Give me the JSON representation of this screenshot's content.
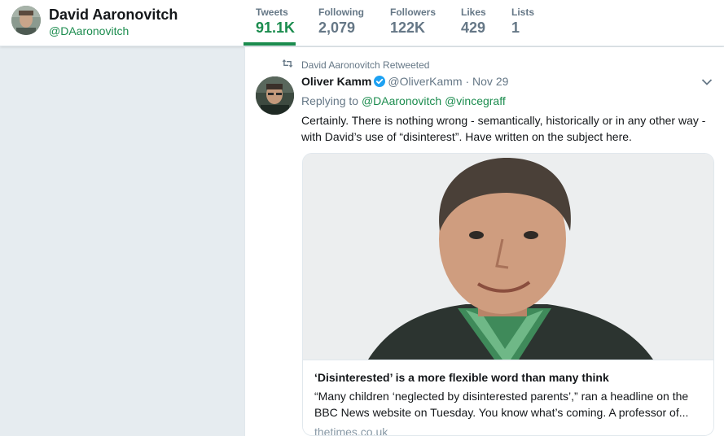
{
  "profile": {
    "name": "David Aaronovitch",
    "handle": "@DAaronovitch"
  },
  "stats": [
    {
      "label": "Tweets",
      "value": "91.1K",
      "active": true
    },
    {
      "label": "Following",
      "value": "2,079",
      "active": false
    },
    {
      "label": "Followers",
      "value": "122K",
      "active": false
    },
    {
      "label": "Likes",
      "value": "429",
      "active": false
    },
    {
      "label": "Lists",
      "value": "1",
      "active": false
    }
  ],
  "tweet": {
    "retweet_context": "David Aaronovitch Retweeted",
    "author_name": "Oliver Kamm",
    "author_handle": "@OliverKamm",
    "time": "· Nov 29",
    "replying_to_label": "Replying to",
    "mentions": [
      "@DAaronovitch",
      "@vincegraff"
    ],
    "text": "Certainly. There is nothing wrong - semantically, historically or in any other way - with David’s use of “disinterest”. Have written on the subject here.",
    "card": {
      "title": "‘Disinterested’ is a more flexible word than many think",
      "description": "“Many children ‘neglected by disinterested parents’,” ran a headline on the BBC News website on Tuesday. You know what’s coming. A professor of...",
      "domain": "thetimes.co.uk"
    }
  },
  "colors": {
    "accent": "#1b8c4e",
    "verified": "#1da1f2",
    "muted": "#657786",
    "background": "#e6ecf0"
  },
  "icons": {
    "retweet": "retweet-icon",
    "verified": "verified-badge-icon",
    "caret": "chevron-down-icon"
  }
}
